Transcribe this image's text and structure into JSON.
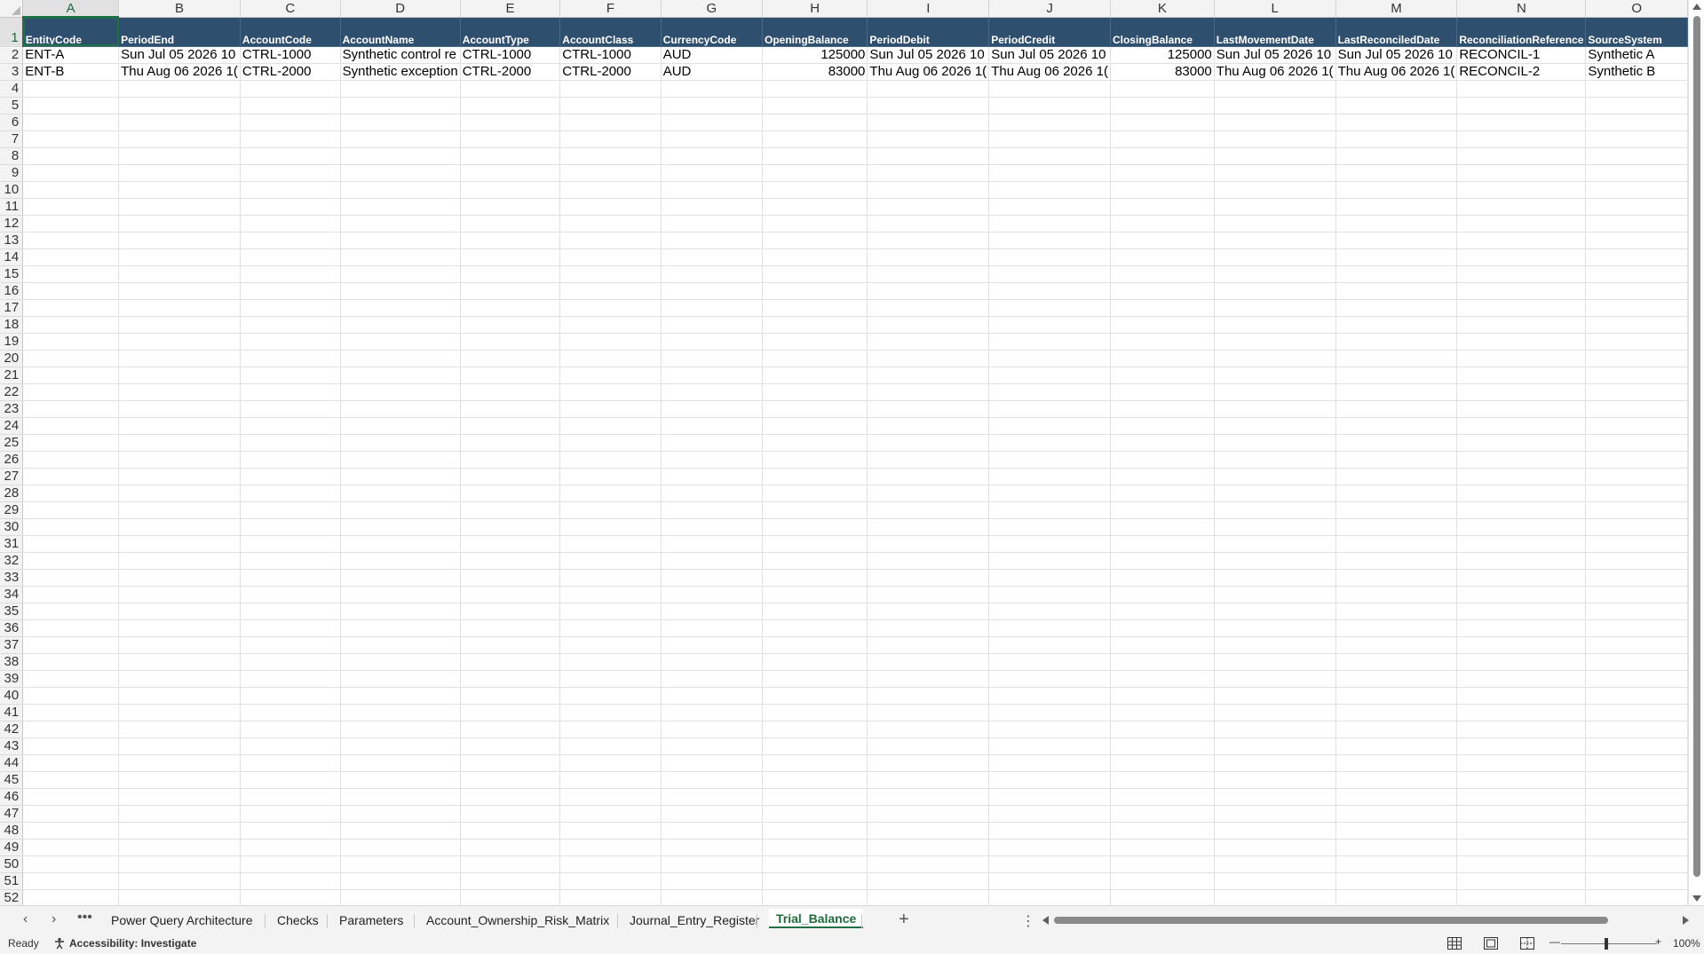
{
  "sheet": {
    "columns": [
      "A",
      "B",
      "C",
      "D",
      "E",
      "F",
      "G",
      "H",
      "I",
      "J",
      "K",
      "L",
      "M",
      "N",
      "O"
    ],
    "active_column": "A",
    "active_row": 1,
    "header_row": [
      "EntityCode",
      "PeriodEnd",
      "AccountCode",
      "AccountName",
      "AccountType",
      "AccountClass",
      "CurrencyCode",
      "OpeningBalance",
      "PeriodDebit",
      "PeriodCredit",
      "ClosingBalance",
      "LastMovementDate",
      "LastReconciledDate",
      "ReconciliationReference",
      "SourceSystem"
    ],
    "data_rows": [
      [
        "ENT-A",
        "Sun Jul 05 2026 10",
        "CTRL-1000",
        "Synthetic control re",
        "CTRL-1000",
        "CTRL-1000",
        "AUD",
        "125000",
        "Sun Jul 05 2026 10",
        "Sun Jul 05 2026 10",
        "125000",
        "Sun Jul 05 2026 10",
        "Sun Jul 05 2026 10",
        "RECONCIL-1",
        "Synthetic A"
      ],
      [
        "ENT-B",
        "Thu Aug 06 2026 1(",
        "CTRL-2000",
        "Synthetic exception",
        "CTRL-2000",
        "CTRL-2000",
        "AUD",
        "83000",
        "Thu Aug 06 2026 1(",
        "Thu Aug 06 2026 1(",
        "83000",
        "Thu Aug 06 2026 1(",
        "Thu Aug 06 2026 1(",
        "RECONCIL-2",
        "Synthetic B"
      ]
    ],
    "numeric_columns": [
      7,
      10
    ],
    "total_rows": 52
  },
  "tabs": {
    "more_label": "•••",
    "items": [
      "Power Query Architecture",
      "Checks",
      "Parameters",
      "Account_Ownership_Risk_Matrix",
      "Journal_Entry_Register",
      "Trial_Balance"
    ],
    "active": "Trial_Balance",
    "add_label": "+",
    "options_label": "⋮"
  },
  "status": {
    "ready": "Ready",
    "accessibility": "Accessibility: Investigate",
    "zoom": "100%",
    "zoom_minus": "—",
    "zoom_plus": "+"
  }
}
